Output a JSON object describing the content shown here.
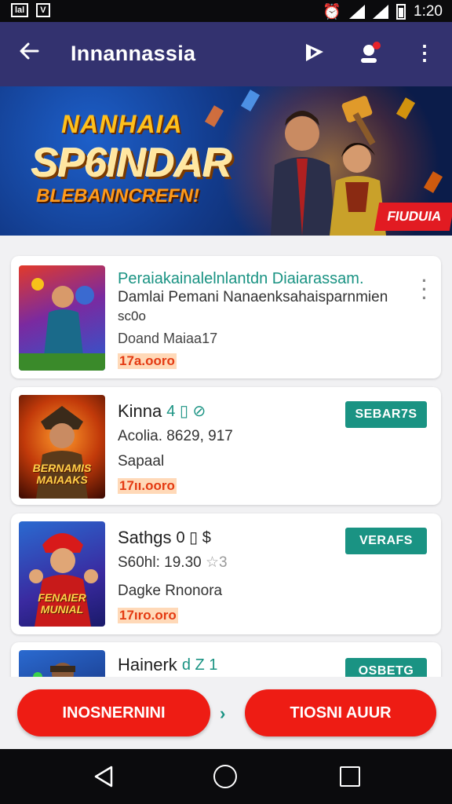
{
  "status_bar": {
    "left_badges": [
      "lal",
      "V"
    ],
    "time": "1:20",
    "icons": [
      "alarm-icon",
      "signal-icon",
      "signal-icon",
      "battery-icon"
    ]
  },
  "app_bar": {
    "title": "Innannassia",
    "back_icon": "arrow-left-icon",
    "actions": [
      "flag-icon",
      "notification-user-icon",
      "more-vert-icon"
    ]
  },
  "banner": {
    "line1": "NANHAIA",
    "line2": "SP6INDAR",
    "line3": "BLEBANNCREFN!",
    "badge": "FIUDUIA"
  },
  "items": [
    {
      "title": "Peraiakainalelnlantdn Diaiarassam.",
      "subtitle": "Damlai Pemani Nanaenksahaisparnmien",
      "line3": "sc0o",
      "line4": "Doand Maiaa17",
      "price": "17a.ooro",
      "thumb_label": "",
      "action": "more"
    },
    {
      "title": "Kinna",
      "title_icons": "4 ▯ ⊘",
      "line2": "Acolia. 8629, 917",
      "line3": "Sapaal",
      "price": "17ıı.ooro",
      "thumb_label": "BERNAMIS MAIAAKS",
      "button": "SEBAR7S"
    },
    {
      "title": "Sathgs",
      "title_icons": "0 ▯ $",
      "line2": "S60hl: 19.30",
      "line2_suffix": "☆3",
      "line3": "Dagke Rnonora",
      "price": "17ıro.oro",
      "thumb_label": "FENAIER MUNIAL",
      "button": "VERAFS"
    },
    {
      "title": "Hainerk",
      "title_icons": "d Z 1",
      "button": "OSBETG"
    }
  ],
  "bottom_actions": {
    "left": "INOSNERNINI",
    "middle": "›",
    "right": "TIOSNI AUUR"
  },
  "colors": {
    "app_bar": "#33326f",
    "accent_teal": "#1a9383",
    "cta_red": "#ee1c14",
    "price": "#e43a12"
  }
}
